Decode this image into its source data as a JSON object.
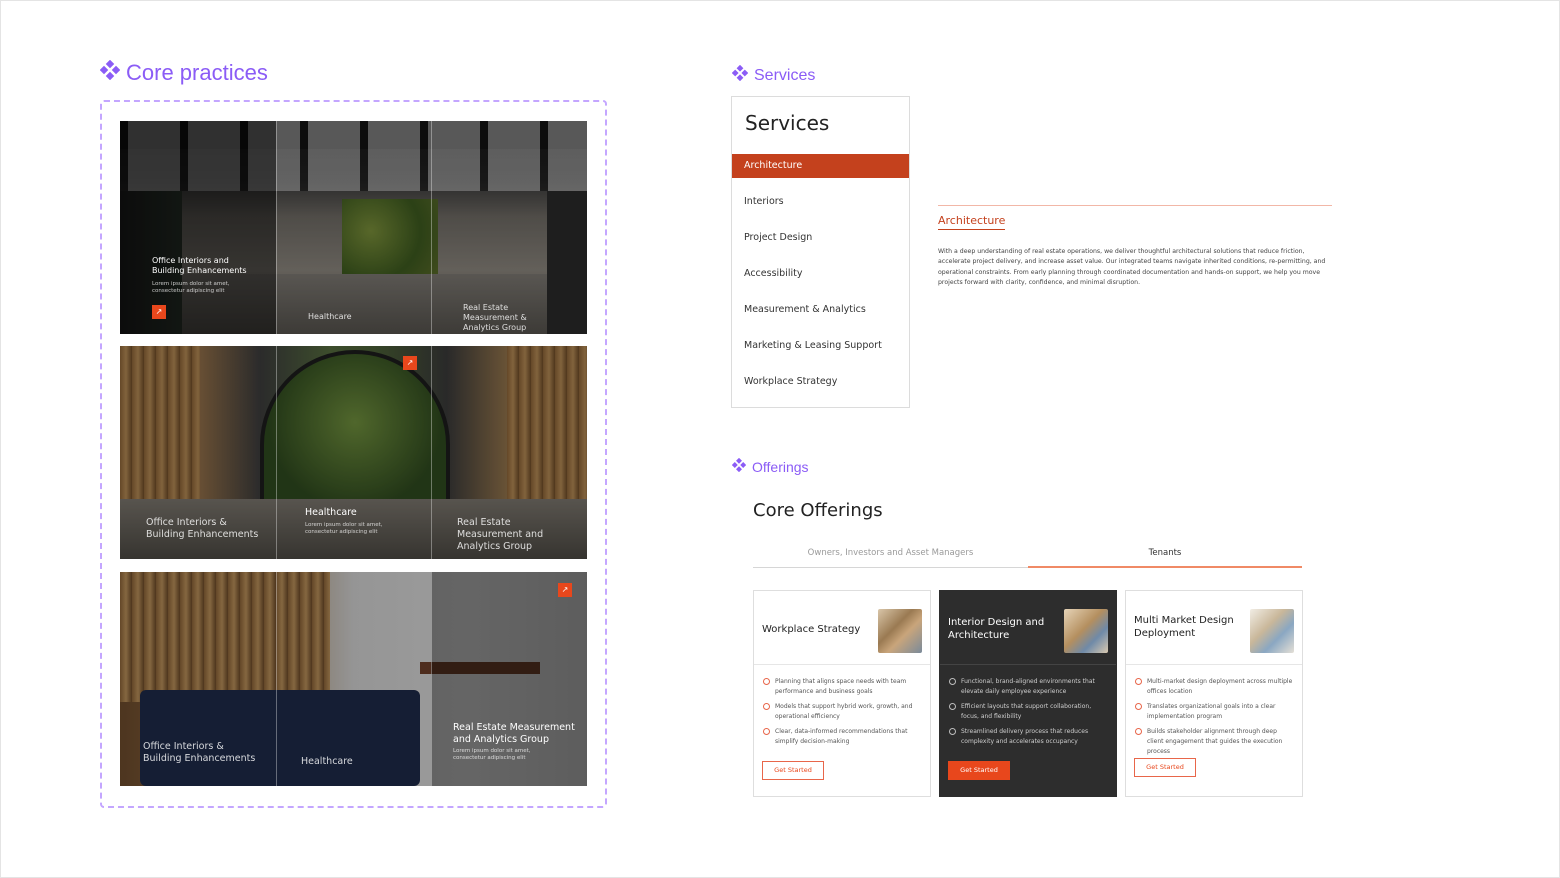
{
  "sections": {
    "core_practices": "Core practices",
    "services": "Services",
    "offerings": "Offerings"
  },
  "icons": {
    "section_marker": "four-diamond-component-icon",
    "arrow": "arrow-up-right-icon"
  },
  "colors": {
    "section_accent": "#8b5cf6",
    "brand_accent": "#c4411d",
    "button_orange": "#e8471c"
  },
  "practice_cards": [
    {
      "col1_title": "Office Interiors and Building Enhancements",
      "col1_sub": "Lorem ipsum dolor sit amet, consectetur adipiscing elit",
      "col2_title": "Healthcare",
      "col3_title": "Real Estate Measurement & Analytics Group",
      "arrow": "↗"
    },
    {
      "col1_title": "Office Interiors & Building Enhancements",
      "col2_title": "Healthcare",
      "col2_sub": "Lorem ipsum dolor sit amet, consectetur adipiscing elit",
      "col3_title": "Real Estate Measurement and Analytics Group",
      "arrow": "↗"
    },
    {
      "col1_title": "Office Interiors & Building Enhancements",
      "col2_title": "Healthcare",
      "col3_title": "Real Estate Measurement and Analytics Group",
      "col3_sub": "Lorem ipsum dolor sit amet, consectetur adipiscing elit",
      "arrow": "↗"
    }
  ],
  "services_panel": {
    "title": "Services",
    "items": [
      "Architecture",
      "Interiors",
      "Project Design",
      "Accessibility",
      "Measurement & Analytics",
      "Marketing & Leasing Support",
      "Workplace Strategy"
    ],
    "selected": "Architecture"
  },
  "service_detail": {
    "title": "Architecture",
    "body": "With a deep understanding of real estate operations, we deliver thoughtful architectural solutions that reduce friction, accelerate project delivery, and increase asset value. Our integrated teams navigate inherited conditions, re-permitting, and operational constraints. From early planning through coordinated documentation and hands-on support, we help you move projects forward with clarity, confidence, and minimal disruption."
  },
  "offerings": {
    "title": "Core Offerings",
    "tabs": [
      "Owners, Investors and Asset Managers",
      "Tenants"
    ],
    "active_tab": "Tenants",
    "cards": [
      {
        "title": "Workplace Strategy",
        "points": [
          "Planning that aligns space needs with team performance and business goals",
          "Models that support hybrid work, growth, and operational efficiency",
          "Clear, data-informed recommendations that simplify decision-making"
        ],
        "button": "Get Started"
      },
      {
        "title": "Interior Design and Architecture",
        "points": [
          "Functional, brand-aligned environments that elevate daily employee experience",
          "Efficient layouts that support collaboration, focus, and flexibility",
          "Streamlined delivery process that reduces complexity and accelerates occupancy"
        ],
        "button": "Get Started"
      },
      {
        "title": "Multi Market Design Deployment",
        "points": [
          "Multi-market design deployment across multiple offices location",
          "Translates organizational goals into a clear implementation program",
          "Builds stakeholder alignment through deep client engagement that guides the execution process"
        ],
        "button": "Get Started"
      }
    ]
  }
}
